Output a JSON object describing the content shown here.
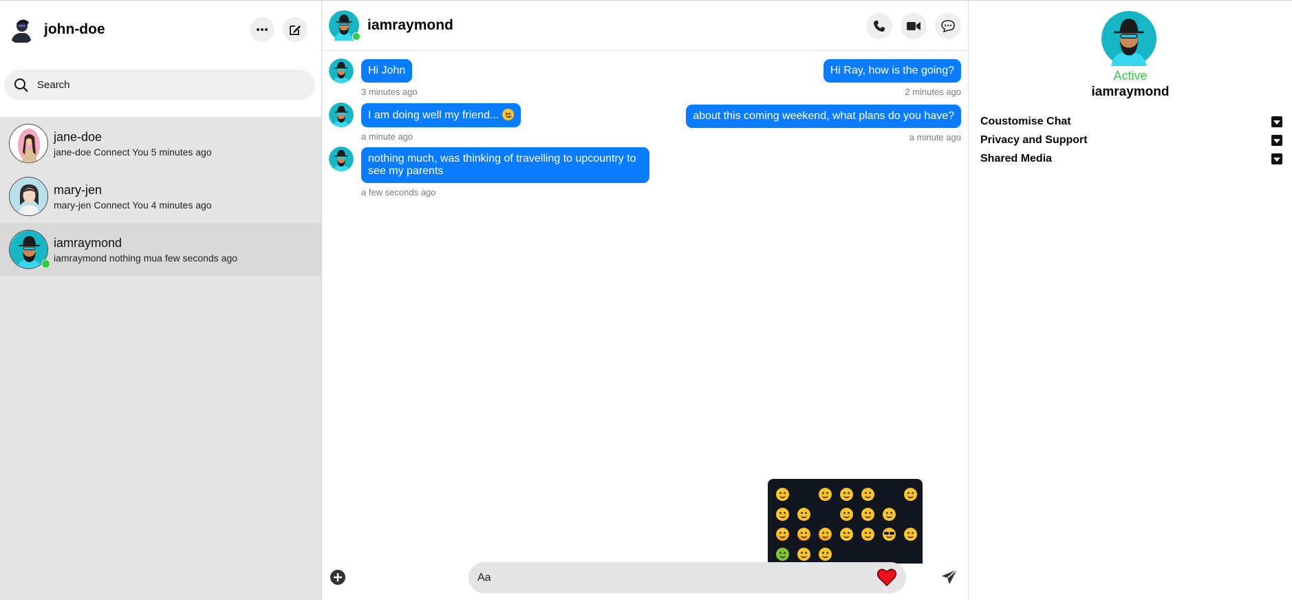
{
  "current_user": {
    "name": "john-doe"
  },
  "search": {
    "placeholder": "Search"
  },
  "conversations": [
    {
      "name": "jane-doe",
      "preview": "jane-doe Connect You 5 minutes ago"
    },
    {
      "name": "mary-jen",
      "preview": "mary-jen Connect You 4 minutes ago"
    },
    {
      "name": "iamraymond",
      "preview": "iamraymond nothing mua few seconds ago"
    }
  ],
  "chat": {
    "title": "iamraymond",
    "messages_in": [
      {
        "text": "Hi John",
        "time": "3 minutes ago"
      },
      {
        "text": "I am doing well my friend... ",
        "time": "a minute ago"
      },
      {
        "text": "nothing much, was thinking of travelling to upcountry to see my parents",
        "time": "a few seconds ago"
      }
    ],
    "messages_out": [
      {
        "text": "Hi Ray, how is the going?",
        "time": "2 minutes ago"
      },
      {
        "text": "about this coming weekend, what plans do you have?",
        "time": "a minute ago"
      }
    ]
  },
  "composer": {
    "placeholder": "Aa"
  },
  "info": {
    "status": "Active",
    "name": "iamraymond",
    "sections": [
      "Coustomise Chat",
      "Privacy and Support",
      "Shared Media"
    ]
  },
  "colors": {
    "accent": "#0a7cff",
    "online": "#31cc46",
    "sidebar_bg": "#e4e4e4",
    "emoji_panel_bg": "#12161f"
  },
  "icons": [
    "more-icon",
    "compose-icon",
    "search-icon",
    "phone-icon",
    "video-icon",
    "chat-info-icon",
    "plus-circle-icon",
    "file-icon",
    "gift-icon",
    "heart-icon",
    "send-icon",
    "caret-down-icon"
  ]
}
